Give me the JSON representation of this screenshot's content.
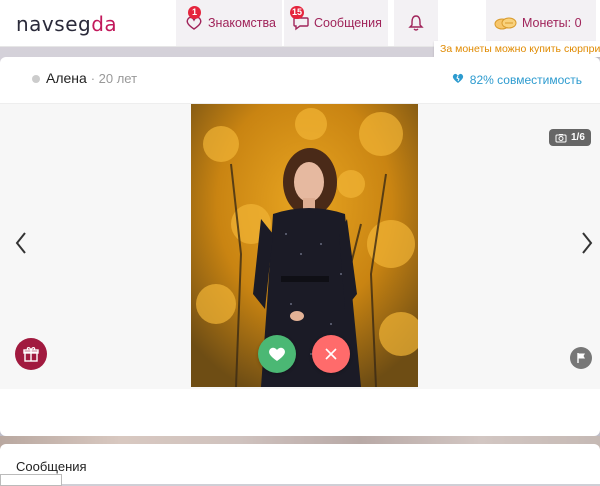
{
  "logo": {
    "part1": "navseg",
    "part2": "da",
    "accent_color": "#c2185b"
  },
  "nav": {
    "dating": {
      "label": "Знакомства",
      "badge": "1",
      "icon": "heart-hands-icon"
    },
    "messages": {
      "label": "Сообщения",
      "badge": "15",
      "icon": "chat-bubble-icon"
    },
    "notifications": {
      "icon": "bell-icon"
    },
    "coins": {
      "label": "Монеты: 0",
      "icon": "coins-icon"
    }
  },
  "coins_hint": "За монеты можно купить сюрпризы",
  "profile": {
    "name": "Алена",
    "age": "· 20 лет",
    "compatibility": "82% совместимость",
    "photo_counter": "1/6"
  },
  "messages_section": {
    "title": "Сообщения"
  },
  "colors": {
    "like": "#4bb874",
    "dislike": "#ff6b6b",
    "gift": "#a11a3f",
    "brand": "#a0245a",
    "compat": "#2d9bcf"
  }
}
